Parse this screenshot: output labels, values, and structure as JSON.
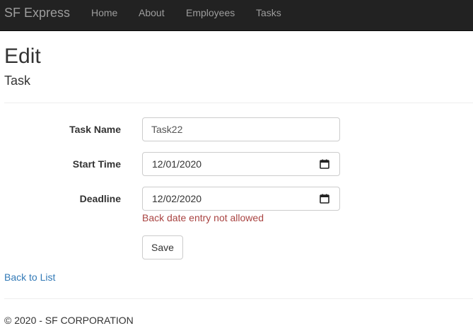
{
  "navbar": {
    "brand": "SF Express",
    "links": [
      {
        "label": "Home"
      },
      {
        "label": "About"
      },
      {
        "label": "Employees"
      },
      {
        "label": "Tasks"
      }
    ]
  },
  "page": {
    "title": "Edit",
    "subtitle": "Task"
  },
  "form": {
    "task_name": {
      "label": "Task Name",
      "value": "Task22"
    },
    "start_time": {
      "label": "Start Time",
      "value": "12/01/2020"
    },
    "deadline": {
      "label": "Deadline",
      "value": "12/02/2020",
      "error": "Back date entry not allowed"
    },
    "save_label": "Save"
  },
  "back_link": "Back to List",
  "footer": "© 2020 - SF CORPORATION",
  "colors": {
    "navbar_bg": "#222222",
    "nav_text": "#9d9d9d",
    "error": "#a94442",
    "link": "#337ab7"
  }
}
